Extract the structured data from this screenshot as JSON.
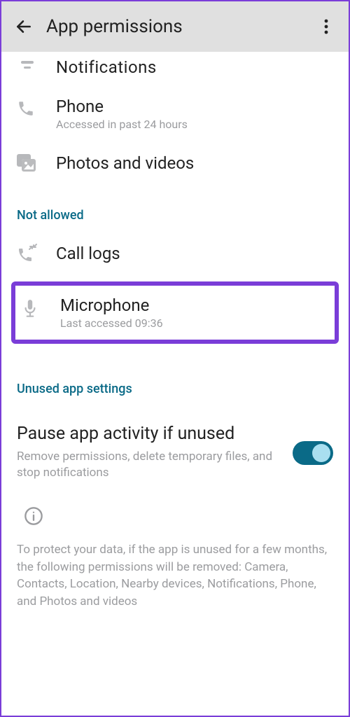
{
  "appbar": {
    "title": "App permissions"
  },
  "allowed": {
    "notifications": {
      "label": "Notifications"
    },
    "phone": {
      "label": "Phone",
      "sub": "Accessed in past 24 hours"
    },
    "photos": {
      "label": "Photos and videos"
    }
  },
  "sections": {
    "not_allowed": "Not allowed",
    "unused": "Unused app settings"
  },
  "not_allowed": {
    "calllogs": {
      "label": "Call logs"
    },
    "microphone": {
      "label": "Microphone",
      "sub": "Last accessed 09:36"
    }
  },
  "pause": {
    "title": "Pause app activity if unused",
    "sub": "Remove permissions, delete temporary files, and stop notifications",
    "enabled": true
  },
  "footer": "To protect your data, if the app is unused for a few months, the following permissions will be removed: Camera, Contacts, Location, Nearby devices, Notifications, Phone, and Photos and videos"
}
